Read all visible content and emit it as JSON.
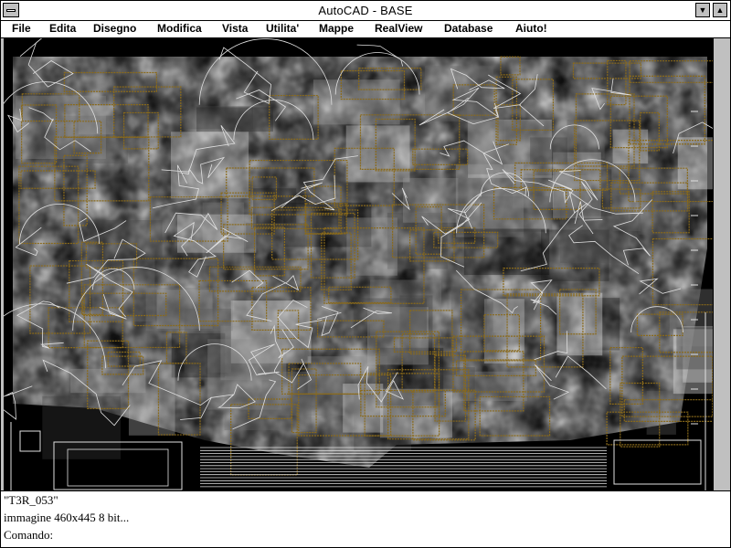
{
  "window": {
    "title": "AutoCAD - BASE",
    "minimize_glyph": "▼",
    "maximize_glyph": "▲"
  },
  "menu": {
    "items": [
      {
        "label": "File"
      },
      {
        "label": "Edita"
      },
      {
        "label": "Disegno"
      },
      {
        "label": "Modifica"
      },
      {
        "label": "Vista"
      },
      {
        "label": "Utilita'"
      },
      {
        "label": "Mappe"
      },
      {
        "label": "RealView"
      },
      {
        "label": "Database"
      },
      {
        "label": "Aiuto!"
      }
    ]
  },
  "drawing": {
    "background_color": "#000000",
    "overlay_color": "#8a6a1a",
    "outline_color": "#e0e0e0"
  },
  "command": {
    "lines": [
      "\"T3R_053\"",
      "immagine 460x445 8 bit...",
      "Comando:"
    ]
  }
}
